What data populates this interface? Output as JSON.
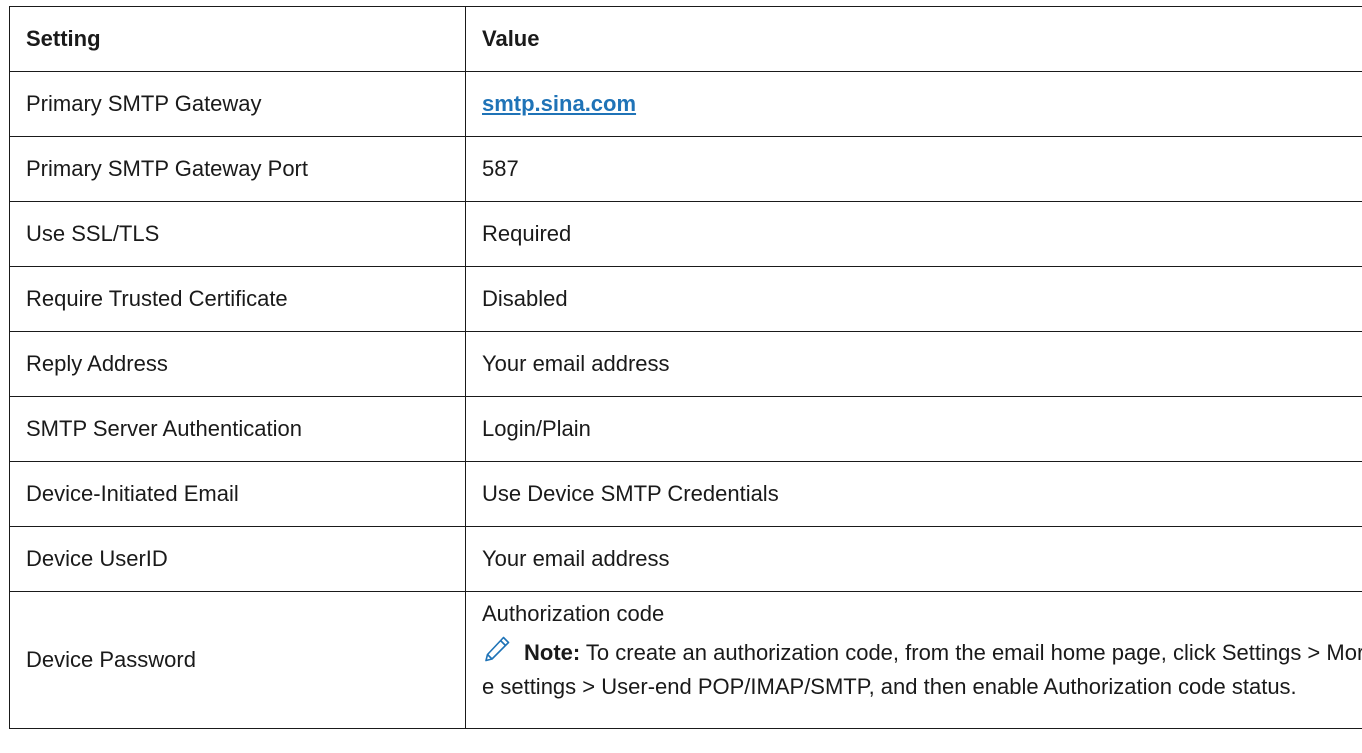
{
  "table": {
    "headers": {
      "setting": "Setting",
      "value": "Value"
    },
    "rows": [
      {
        "setting": "Primary SMTP Gateway",
        "value": "smtp.sina.com"
      },
      {
        "setting": "Primary SMTP Gateway Port",
        "value": "587"
      },
      {
        "setting": "Use SSL/TLS",
        "value": "Required"
      },
      {
        "setting": "Require Trusted Certificate",
        "value": "Disabled"
      },
      {
        "setting": "Reply Address",
        "value": "Your email address"
      },
      {
        "setting": "SMTP Server Authentication",
        "value": "Login/Plain"
      },
      {
        "setting": "Device-Initiated Email",
        "value": "Use Device SMTP Credentials"
      },
      {
        "setting": "Device UserID",
        "value": "Your email address"
      },
      {
        "setting": "Device Password",
        "value": "Authorization code"
      }
    ],
    "note": {
      "icon": "pencil-icon",
      "label": "Note:",
      "text": " To create an authorization code, from the email home page, click Settings > More settings > User-end POP/IMAP/SMTP, and then enable Authorization code status."
    }
  },
  "colors": {
    "link": "#1f73b7",
    "border": "#1a1a1a",
    "icon": "#1f73b7"
  }
}
